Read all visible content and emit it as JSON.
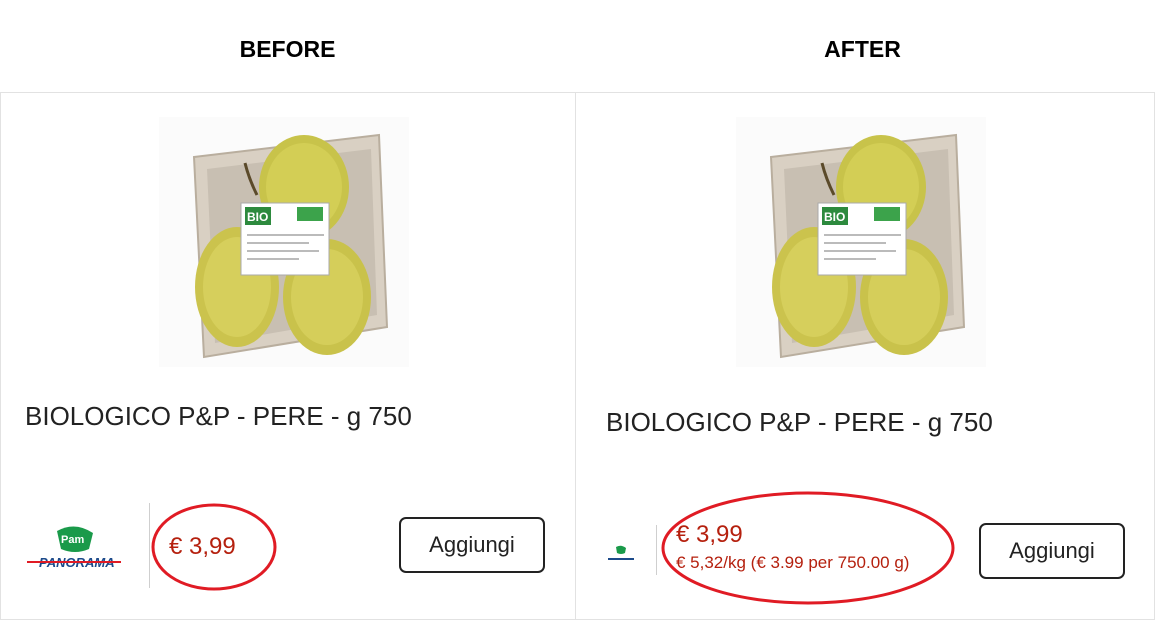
{
  "headings": {
    "before": "BEFORE",
    "after": "AFTER"
  },
  "before": {
    "product_title": "BIOLOGICO P&P - PERE - g 750",
    "price": "€ 3,99",
    "add_button_label": "Aggiungi",
    "store_logo_text": {
      "pam": "Pam",
      "panorama": "PANORAMA"
    }
  },
  "after": {
    "product_title": "BIOLOGICO P&P - PERE - g 750",
    "price": "€ 3,99",
    "unit_price": "€ 5,32/kg (€ 3.99 per 750.00 g)",
    "add_button_label": "Aggiungi"
  },
  "colors": {
    "price": "#b5200e",
    "highlight": "#e01b24",
    "pam_green": "#1a9a4a"
  },
  "product_image_labels": {
    "bio_badge": "BIO"
  }
}
